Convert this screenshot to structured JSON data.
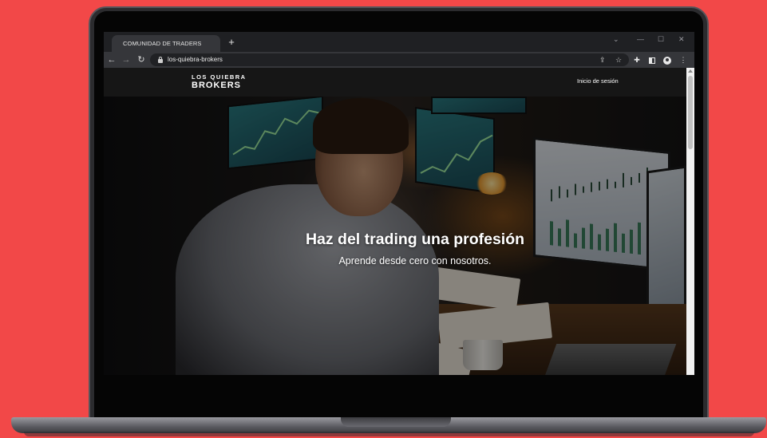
{
  "browser": {
    "tab_title": "COMUNIDAD DE TRADERS",
    "new_tab_label": "+",
    "url": "los-quiebra-brokers"
  },
  "site": {
    "logo_line1": "LOS QUIEBRA",
    "logo_line2": "BROKERS",
    "login_label": "Inicio de sesión"
  },
  "hero": {
    "title": "Haz del trading una profesión",
    "subtitle": "Aprende desde cero con nosotros."
  },
  "colors": {
    "background": "#f24848",
    "chrome_dark": "#1f2023",
    "toolbar": "#35363a",
    "site_nav": "#161616"
  }
}
